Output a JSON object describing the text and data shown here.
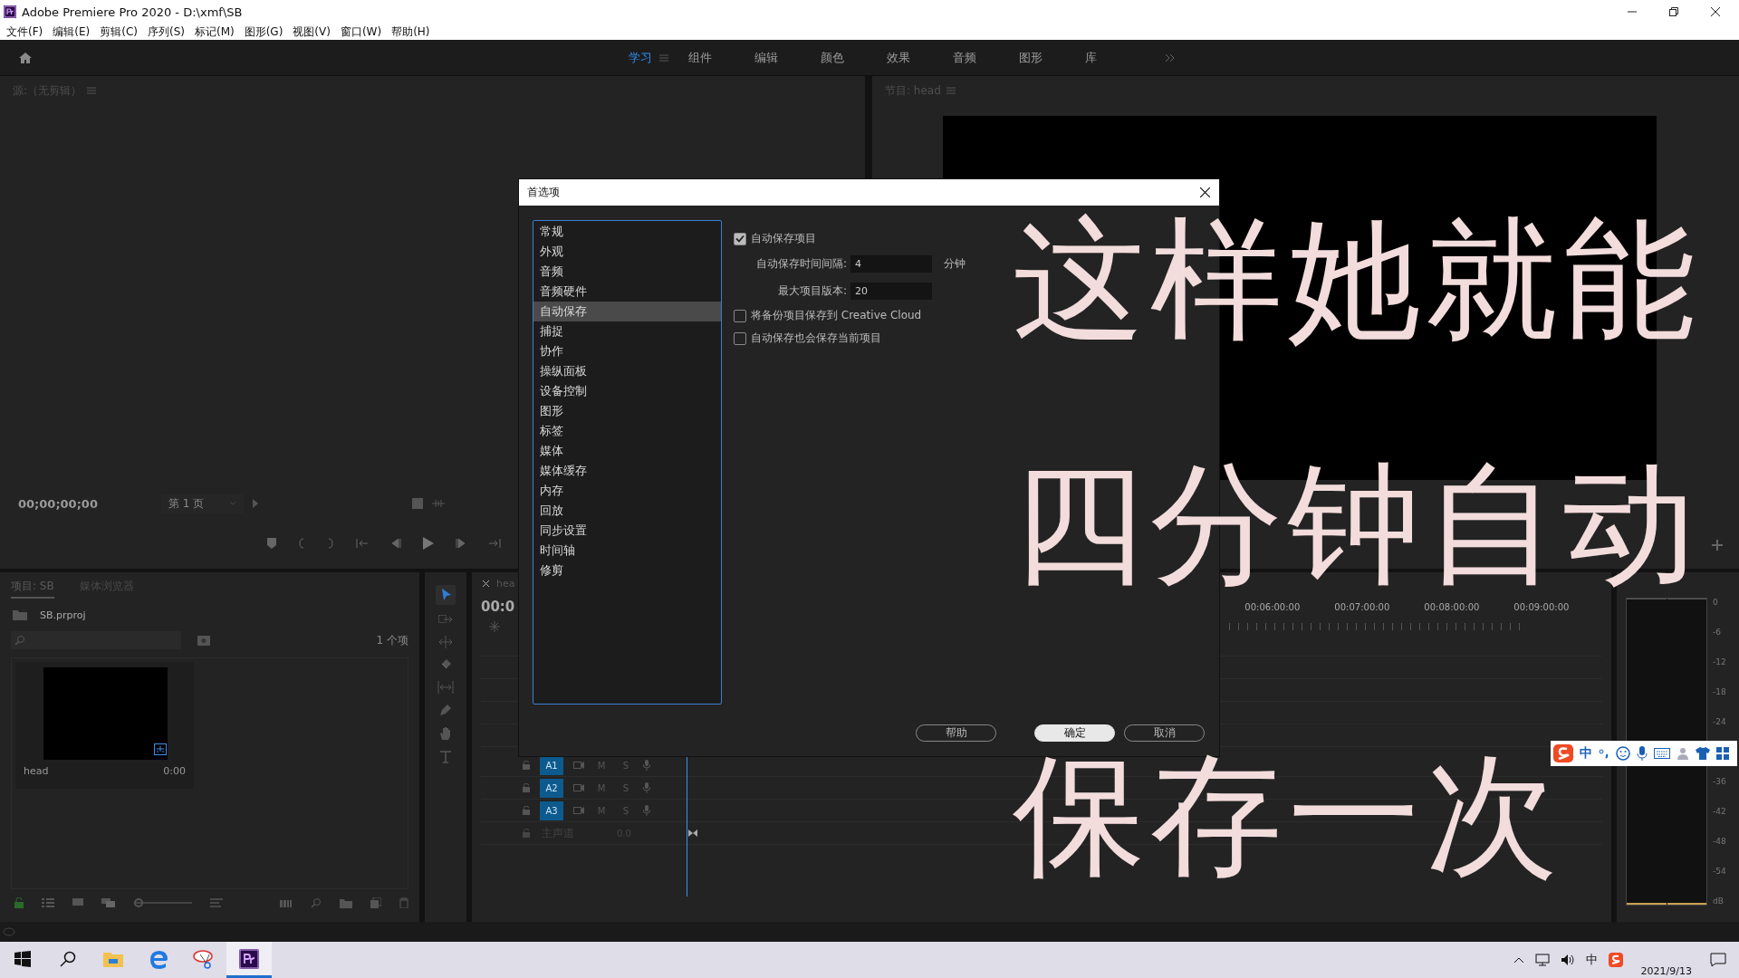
{
  "window": {
    "title": "Adobe Premiere Pro 2020 - D:\\xmf\\SB"
  },
  "menu": [
    "文件(F)",
    "编辑(E)",
    "剪辑(C)",
    "序列(S)",
    "标记(M)",
    "图形(G)",
    "视图(V)",
    "窗口(W)",
    "帮助(H)"
  ],
  "workspaces": [
    {
      "label": "学习",
      "selected": true
    },
    {
      "label": "组件",
      "selected": false
    },
    {
      "label": "编辑",
      "selected": false
    },
    {
      "label": "颜色",
      "selected": false
    },
    {
      "label": "效果",
      "selected": false
    },
    {
      "label": "音频",
      "selected": false
    },
    {
      "label": "图形",
      "selected": false
    },
    {
      "label": "库",
      "selected": false
    }
  ],
  "source_monitor": {
    "title": "源:（无剪辑）",
    "timecode": "00;00;00;00",
    "page": "第 1 页"
  },
  "program_monitor": {
    "title": "节目: head"
  },
  "project_panel": {
    "tabs": [
      {
        "label": "项目: SB",
        "selected": true
      },
      {
        "label": "媒体浏览器",
        "selected": false
      }
    ],
    "file": "SB.prproj",
    "count": "1 个项",
    "zoom": {
      "level": 0
    },
    "clips": [
      {
        "name": "head",
        "duration": "0:00"
      }
    ]
  },
  "timeline": {
    "tab": "hea",
    "timecode": "00:0",
    "ruler": [
      "00:06:00:00",
      "00:07:00:00",
      "00:08:00:00",
      "00:09:00:00"
    ],
    "tracks": [
      {
        "name": "A1",
        "mute": "M",
        "solo": "S"
      },
      {
        "name": "A2",
        "mute": "M",
        "solo": "S"
      },
      {
        "name": "A3",
        "mute": "M",
        "solo": "S"
      }
    ],
    "master": {
      "name": "主声道",
      "value": "0.0"
    }
  },
  "audio_meter": {
    "scale": [
      "0",
      "-6",
      "-12",
      "-18",
      "-24",
      "-36",
      "-42",
      "-48",
      "-54",
      "dB"
    ]
  },
  "dialog": {
    "title": "首选项",
    "categories": [
      {
        "label": "常规",
        "selected": false
      },
      {
        "label": "外观",
        "selected": false
      },
      {
        "label": "音频",
        "selected": false
      },
      {
        "label": "音频硬件",
        "selected": false
      },
      {
        "label": "自动保存",
        "selected": true
      },
      {
        "label": "捕捉",
        "selected": false
      },
      {
        "label": "协作",
        "selected": false
      },
      {
        "label": "操纵面板",
        "selected": false
      },
      {
        "label": "设备控制",
        "selected": false
      },
      {
        "label": "图形",
        "selected": false
      },
      {
        "label": "标签",
        "selected": false
      },
      {
        "label": "媒体",
        "selected": false
      },
      {
        "label": "媒体缓存",
        "selected": false
      },
      {
        "label": "内存",
        "selected": false
      },
      {
        "label": "回放",
        "selected": false
      },
      {
        "label": "同步设置",
        "selected": false
      },
      {
        "label": "时间轴",
        "selected": false
      },
      {
        "label": "修剪",
        "selected": false
      }
    ],
    "options": [
      {
        "kind": "checkbox",
        "label": "自动保存项目",
        "checked": true
      },
      {
        "kind": "field",
        "label": "自动保存时间间隔:",
        "value": "4",
        "unit": "分钟"
      },
      {
        "kind": "field",
        "label": "最大项目版本:",
        "value": "20"
      },
      {
        "kind": "checkbox",
        "label": "将备份项目保存到 Creative Cloud",
        "checked": false
      },
      {
        "kind": "checkbox",
        "label": "自动保存也会保存当前项目",
        "checked": false
      }
    ],
    "buttons": [
      {
        "label": "帮助",
        "primary": false
      },
      {
        "label": "确定",
        "primary": true
      },
      {
        "label": "取消",
        "primary": false
      }
    ]
  },
  "caption": {
    "lines": [
      "这样她就能",
      "四分钟自动",
      "保存一次"
    ]
  },
  "ime_bar": {
    "mode": "中"
  },
  "taskbar": {
    "apps": [
      {
        "kind": "start",
        "selected": false
      },
      {
        "kind": "search",
        "selected": false
      },
      {
        "kind": "explorer",
        "selected": false
      },
      {
        "kind": "browser",
        "selected": false
      },
      {
        "kind": "snipping",
        "selected": false
      },
      {
        "kind": "premiere",
        "selected": true
      }
    ],
    "tray": {
      "ime": "中",
      "date": "2021/9/13"
    }
  }
}
